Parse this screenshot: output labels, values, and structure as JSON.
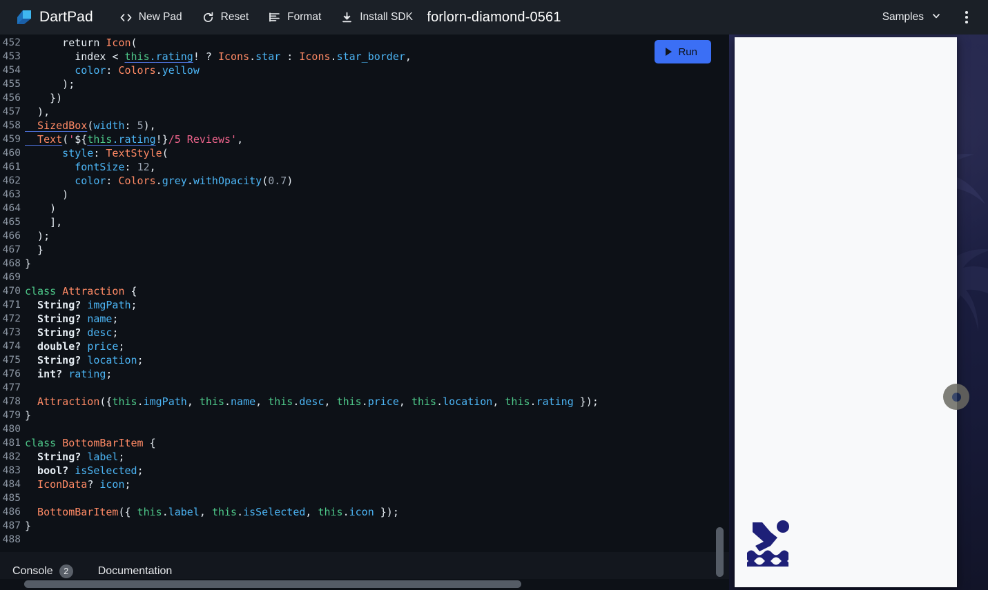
{
  "header": {
    "brand": "DartPad",
    "brand_color": "#2f8fe0",
    "doc_title": "forlorn-diamond-0561",
    "toolbar": [
      {
        "label": "New Pad",
        "icon": "code-brackets-icon"
      },
      {
        "label": "Reset",
        "icon": "refresh-icon"
      },
      {
        "label": "Format",
        "icon": "format-lines-icon"
      },
      {
        "label": "Install SDK",
        "icon": "download-icon"
      }
    ],
    "samples_label": "Samples",
    "more_menu": "more-vert-icon"
  },
  "editor": {
    "run_label": "Run",
    "run_color": "#3b6ff5",
    "first_line": 452,
    "last_line": 488,
    "lines": [
      {
        "n": "452",
        "tokens": [
          {
            "t": "      return ",
            "c": "p"
          },
          {
            "t": "Icon",
            "c": "ty"
          },
          {
            "t": "(",
            "c": "p"
          }
        ]
      },
      {
        "n": "453",
        "tokens": [
          {
            "t": "        index ",
            "c": "p"
          },
          {
            "t": "<",
            "c": "p"
          },
          {
            "t": " ",
            "c": "p"
          },
          {
            "t": "this",
            "c": "th"
          },
          {
            "t": ".",
            "c": "thp"
          },
          {
            "t": "rating",
            "c": "thp"
          },
          {
            "t": "! ? ",
            "c": "p"
          },
          {
            "t": "Icons",
            "c": "ty"
          },
          {
            "t": ".",
            "c": "p"
          },
          {
            "t": "star",
            "c": "id"
          },
          {
            "t": " : ",
            "c": "p"
          },
          {
            "t": "Icons",
            "c": "ty"
          },
          {
            "t": ".",
            "c": "p"
          },
          {
            "t": "star_border",
            "c": "id"
          },
          {
            "t": ",",
            "c": "p"
          }
        ]
      },
      {
        "n": "454",
        "tokens": [
          {
            "t": "        color",
            "c": "id"
          },
          {
            "t": ": ",
            "c": "p"
          },
          {
            "t": "Colors",
            "c": "ty"
          },
          {
            "t": ".",
            "c": "p"
          },
          {
            "t": "yellow",
            "c": "id"
          }
        ]
      },
      {
        "n": "455",
        "tokens": [
          {
            "t": "      );",
            "c": "p"
          }
        ]
      },
      {
        "n": "456",
        "tokens": [
          {
            "t": "    })",
            "c": "p"
          }
        ]
      },
      {
        "n": "457",
        "tokens": [
          {
            "t": "  ),",
            "c": "p"
          }
        ]
      },
      {
        "n": "458",
        "tokens": [
          {
            "t": "  SizedBox",
            "c": "tyu"
          },
          {
            "t": "(",
            "c": "p"
          },
          {
            "t": "width",
            "c": "id"
          },
          {
            "t": ": ",
            "c": "p"
          },
          {
            "t": "5",
            "c": "nm"
          },
          {
            "t": "),",
            "c": "p"
          }
        ]
      },
      {
        "n": "459",
        "tokens": [
          {
            "t": "  Text",
            "c": "tyu"
          },
          {
            "t": "(",
            "c": "p"
          },
          {
            "t": "'",
            "c": "st"
          },
          {
            "t": "${",
            "c": "p"
          },
          {
            "t": "this",
            "c": "th"
          },
          {
            "t": ".",
            "c": "thp"
          },
          {
            "t": "rating",
            "c": "thp"
          },
          {
            "t": "!}",
            "c": "p"
          },
          {
            "t": "/5 Reviews'",
            "c": "st"
          },
          {
            "t": ",",
            "c": "p"
          }
        ]
      },
      {
        "n": "460",
        "tokens": [
          {
            "t": "      style",
            "c": "id"
          },
          {
            "t": ": ",
            "c": "p"
          },
          {
            "t": "TextStyle",
            "c": "ty"
          },
          {
            "t": "(",
            "c": "p"
          }
        ]
      },
      {
        "n": "461",
        "tokens": [
          {
            "t": "        fontSize",
            "c": "id"
          },
          {
            "t": ": ",
            "c": "p"
          },
          {
            "t": "12",
            "c": "nm"
          },
          {
            "t": ",",
            "c": "p"
          }
        ]
      },
      {
        "n": "462",
        "tokens": [
          {
            "t": "        color",
            "c": "id"
          },
          {
            "t": ": ",
            "c": "p"
          },
          {
            "t": "Colors",
            "c": "ty"
          },
          {
            "t": ".",
            "c": "p"
          },
          {
            "t": "grey",
            "c": "id"
          },
          {
            "t": ".",
            "c": "p"
          },
          {
            "t": "withOpacity",
            "c": "id"
          },
          {
            "t": "(",
            "c": "p"
          },
          {
            "t": "0.7",
            "c": "nm"
          },
          {
            "t": ")",
            "c": "p"
          }
        ]
      },
      {
        "n": "463",
        "tokens": [
          {
            "t": "      )",
            "c": "p"
          }
        ]
      },
      {
        "n": "464",
        "tokens": [
          {
            "t": "    )",
            "c": "p"
          }
        ]
      },
      {
        "n": "465",
        "tokens": [
          {
            "t": "    ],",
            "c": "p"
          }
        ]
      },
      {
        "n": "466",
        "tokens": [
          {
            "t": "  );",
            "c": "p"
          }
        ]
      },
      {
        "n": "467",
        "tokens": [
          {
            "t": "  }",
            "c": "p"
          }
        ]
      },
      {
        "n": "468",
        "tokens": [
          {
            "t": "}",
            "c": "p"
          }
        ]
      },
      {
        "n": "469",
        "tokens": []
      },
      {
        "n": "470",
        "tokens": [
          {
            "t": "class",
            "c": "k"
          },
          {
            "t": " ",
            "c": "p"
          },
          {
            "t": "Attraction",
            "c": "ty"
          },
          {
            "t": " {",
            "c": "p"
          }
        ]
      },
      {
        "n": "471",
        "tokens": [
          {
            "t": "  String?",
            "c": "bi"
          },
          {
            "t": " ",
            "c": "p"
          },
          {
            "t": "imgPath",
            "c": "id"
          },
          {
            "t": ";",
            "c": "p"
          }
        ]
      },
      {
        "n": "472",
        "tokens": [
          {
            "t": "  String?",
            "c": "bi"
          },
          {
            "t": " ",
            "c": "p"
          },
          {
            "t": "name",
            "c": "id"
          },
          {
            "t": ";",
            "c": "p"
          }
        ]
      },
      {
        "n": "473",
        "tokens": [
          {
            "t": "  String?",
            "c": "bi"
          },
          {
            "t": " ",
            "c": "p"
          },
          {
            "t": "desc",
            "c": "id"
          },
          {
            "t": ";",
            "c": "p"
          }
        ]
      },
      {
        "n": "474",
        "tokens": [
          {
            "t": "  double?",
            "c": "bi"
          },
          {
            "t": " ",
            "c": "p"
          },
          {
            "t": "price",
            "c": "id"
          },
          {
            "t": ";",
            "c": "p"
          }
        ]
      },
      {
        "n": "475",
        "tokens": [
          {
            "t": "  String?",
            "c": "bi"
          },
          {
            "t": " ",
            "c": "p"
          },
          {
            "t": "location",
            "c": "id"
          },
          {
            "t": ";",
            "c": "p"
          }
        ]
      },
      {
        "n": "476",
        "tokens": [
          {
            "t": "  int?",
            "c": "bi"
          },
          {
            "t": " ",
            "c": "p"
          },
          {
            "t": "rating",
            "c": "id"
          },
          {
            "t": ";",
            "c": "p"
          }
        ]
      },
      {
        "n": "477",
        "tokens": []
      },
      {
        "n": "478",
        "tokens": [
          {
            "t": "  Attraction",
            "c": "ty"
          },
          {
            "t": "({",
            "c": "p"
          },
          {
            "t": "this",
            "c": "thn"
          },
          {
            "t": ".",
            "c": "p"
          },
          {
            "t": "imgPath",
            "c": "id"
          },
          {
            "t": ", ",
            "c": "p"
          },
          {
            "t": "this",
            "c": "thn"
          },
          {
            "t": ".",
            "c": "p"
          },
          {
            "t": "name",
            "c": "id"
          },
          {
            "t": ", ",
            "c": "p"
          },
          {
            "t": "this",
            "c": "thn"
          },
          {
            "t": ".",
            "c": "p"
          },
          {
            "t": "desc",
            "c": "id"
          },
          {
            "t": ", ",
            "c": "p"
          },
          {
            "t": "this",
            "c": "thn"
          },
          {
            "t": ".",
            "c": "p"
          },
          {
            "t": "price",
            "c": "id"
          },
          {
            "t": ", ",
            "c": "p"
          },
          {
            "t": "this",
            "c": "thn"
          },
          {
            "t": ".",
            "c": "p"
          },
          {
            "t": "location",
            "c": "id"
          },
          {
            "t": ", ",
            "c": "p"
          },
          {
            "t": "this",
            "c": "thn"
          },
          {
            "t": ".",
            "c": "p"
          },
          {
            "t": "rating",
            "c": "id"
          },
          {
            "t": " });",
            "c": "p"
          }
        ]
      },
      {
        "n": "479",
        "tokens": [
          {
            "t": "}",
            "c": "p"
          }
        ]
      },
      {
        "n": "480",
        "tokens": []
      },
      {
        "n": "481",
        "tokens": [
          {
            "t": "class",
            "c": "k"
          },
          {
            "t": " ",
            "c": "p"
          },
          {
            "t": "BottomBarItem",
            "c": "ty"
          },
          {
            "t": " {",
            "c": "p"
          }
        ]
      },
      {
        "n": "482",
        "tokens": [
          {
            "t": "  String?",
            "c": "bi"
          },
          {
            "t": " ",
            "c": "p"
          },
          {
            "t": "label",
            "c": "id"
          },
          {
            "t": ";",
            "c": "p"
          }
        ]
      },
      {
        "n": "483",
        "tokens": [
          {
            "t": "  bool?",
            "c": "bi"
          },
          {
            "t": " ",
            "c": "p"
          },
          {
            "t": "isSelected",
            "c": "id"
          },
          {
            "t": ";",
            "c": "p"
          }
        ]
      },
      {
        "n": "484",
        "tokens": [
          {
            "t": "  IconData",
            "c": "ty"
          },
          {
            "t": "? ",
            "c": "p"
          },
          {
            "t": "icon",
            "c": "id"
          },
          {
            "t": ";",
            "c": "p"
          }
        ]
      },
      {
        "n": "485",
        "tokens": []
      },
      {
        "n": "486",
        "tokens": [
          {
            "t": "  BottomBarItem",
            "c": "ty"
          },
          {
            "t": "({ ",
            "c": "p"
          },
          {
            "t": "this",
            "c": "thn"
          },
          {
            "t": ".",
            "c": "p"
          },
          {
            "t": "label",
            "c": "id"
          },
          {
            "t": ", ",
            "c": "p"
          },
          {
            "t": "this",
            "c": "thn"
          },
          {
            "t": ".",
            "c": "p"
          },
          {
            "t": "isSelected",
            "c": "id"
          },
          {
            "t": ", ",
            "c": "p"
          },
          {
            "t": "this",
            "c": "thn"
          },
          {
            "t": ".",
            "c": "p"
          },
          {
            "t": "icon",
            "c": "id"
          },
          {
            "t": " });",
            "c": "p"
          }
        ]
      },
      {
        "n": "487",
        "tokens": [
          {
            "t": "}",
            "c": "p"
          }
        ]
      },
      {
        "n": "488",
        "tokens": []
      }
    ]
  },
  "console": {
    "tabs": [
      {
        "label": "Console",
        "badge": "2"
      },
      {
        "label": "Documentation",
        "badge": null
      }
    ]
  },
  "preview": {
    "app_background_color": "#f8f9fa",
    "photo_description": "dark-navy-palm-tree-photo",
    "icon": "swimming-pool-icon",
    "icon_color": "#1e2078"
  }
}
